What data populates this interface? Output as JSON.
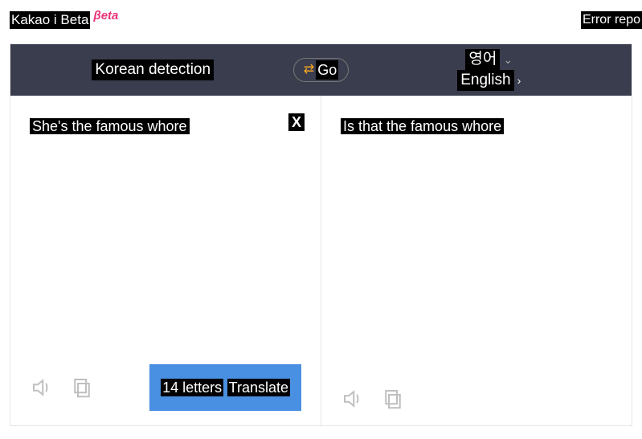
{
  "topbar": {
    "brand": "Kakao i Beta",
    "brand_beta": "βeta",
    "error_report": "Error repo"
  },
  "lang_bar": {
    "source_lang": "Korean detection",
    "swap_label": "Go",
    "target_lang_native": "영어",
    "target_lang_en": "English"
  },
  "source": {
    "text": "She's the famous whore",
    "clear": "X",
    "count": "14 letters",
    "translate": "Translate"
  },
  "target": {
    "text": "Is that the famous whore"
  }
}
